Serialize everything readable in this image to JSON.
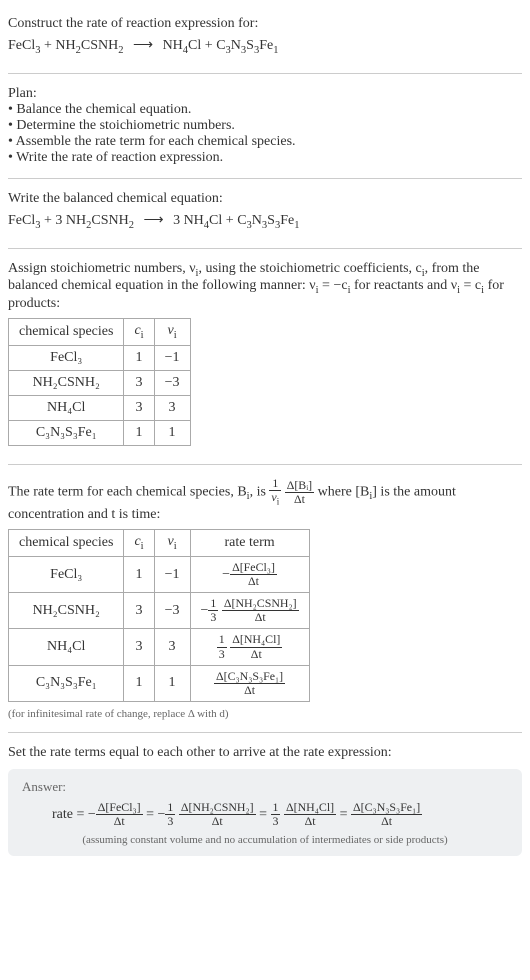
{
  "prompt": {
    "title": "Construct the rate of reaction expression for:",
    "eq_lhs1": "FeCl",
    "eq_lhs1_sub": "3",
    "plus1": " + ",
    "eq_lhs2": "NH",
    "eq_lhs2_sub1": "2",
    "eq_lhs2_mid": "CSNH",
    "eq_lhs2_sub2": "2",
    "arrow": "⟶",
    "eq_rhs1": "NH",
    "eq_rhs1_sub": "4",
    "eq_rhs1_tail": "Cl",
    "plus2": " + ",
    "eq_rhs2": "C",
    "eq_rhs2_sub1": "3",
    "eq_rhs2_mid1": "N",
    "eq_rhs2_sub2": "3",
    "eq_rhs2_mid2": "S",
    "eq_rhs2_sub3": "3",
    "eq_rhs2_mid3": "Fe",
    "eq_rhs2_sub4": "1"
  },
  "plan": {
    "heading": "Plan:",
    "items": [
      "Balance the chemical equation.",
      "Determine the stoichiometric numbers.",
      "Assemble the rate term for each chemical species.",
      "Write the rate of reaction expression."
    ]
  },
  "balanced": {
    "heading": "Write the balanced chemical equation:",
    "c1": "FeCl",
    "c1s": "3",
    "plus1": " + 3 ",
    "c2a": "NH",
    "c2s1": "2",
    "c2b": "CSNH",
    "c2s2": "2",
    "arrow": "⟶",
    "c3pre": " 3 ",
    "c3a": "NH",
    "c3s": "4",
    "c3b": "Cl",
    "plus2": " + ",
    "c4a": "C",
    "c4s1": "3",
    "c4b": "N",
    "c4s2": "3",
    "c4c": "S",
    "c4s3": "3",
    "c4d": "Fe",
    "c4s4": "1"
  },
  "stoich": {
    "text1": "Assign stoichiometric numbers, ν",
    "text1_sub": "i",
    "text2": ", using the stoichiometric coefficients, c",
    "text2_sub": "i",
    "text3": ", from the balanced chemical equation in the following manner: ν",
    "text3_sub": "i",
    "text4": " = −c",
    "text4_sub": "i",
    "text5": " for reactants and ν",
    "text5_sub": "i",
    "text6": " = c",
    "text6_sub": "i",
    "text7": " for products:",
    "headers": [
      "chemical species",
      "cᵢ",
      "νᵢ"
    ],
    "rows": [
      {
        "sp": "FeCl₃",
        "c": "1",
        "v": "−1"
      },
      {
        "sp": "NH₂CSNH₂",
        "c": "3",
        "v": "−3"
      },
      {
        "sp": "NH₄Cl",
        "c": "3",
        "v": "3"
      },
      {
        "sp": "C₃N₃S₃Fe₁",
        "c": "1",
        "v": "1"
      }
    ]
  },
  "rateterm_intro": {
    "t1": "The rate term for each chemical species, B",
    "t1_sub": "i",
    "t2": ", is ",
    "f1_num": "1",
    "f1_den": "νᵢ",
    "f2_num": "Δ[Bᵢ]",
    "f2_den": "Δt",
    "t3": " where [B",
    "t3_sub": "i",
    "t4": "] is the amount concentration and t is time:"
  },
  "rateterm_table": {
    "headers": [
      "chemical species",
      "cᵢ",
      "νᵢ",
      "rate term"
    ],
    "rows": [
      {
        "sp": "FeCl₃",
        "c": "1",
        "v": "−1",
        "neg": "−",
        "coef_num": "",
        "coef_den": "",
        "num": "Δ[FeCl₃]",
        "den": "Δt"
      },
      {
        "sp": "NH₂CSNH₂",
        "c": "3",
        "v": "−3",
        "neg": "−",
        "coef_num": "1",
        "coef_den": "3",
        "num": "Δ[NH₂CSNH₂]",
        "den": "Δt"
      },
      {
        "sp": "NH₄Cl",
        "c": "3",
        "v": "3",
        "neg": "",
        "coef_num": "1",
        "coef_den": "3",
        "num": "Δ[NH₄Cl]",
        "den": "Δt"
      },
      {
        "sp": "C₃N₃S₃Fe₁",
        "c": "1",
        "v": "1",
        "neg": "",
        "coef_num": "",
        "coef_den": "",
        "num": "Δ[C₃N₃S₃Fe₁]",
        "den": "Δt"
      }
    ],
    "note": "(for infinitesimal rate of change, replace Δ with d)"
  },
  "final": {
    "heading": "Set the rate terms equal to each other to arrive at the rate expression:",
    "answer_label": "Answer:",
    "rate_label": "rate = −",
    "t1_num": "Δ[FeCl₃]",
    "t1_den": "Δt",
    "eq1": " = −",
    "c2_num": "1",
    "c2_den": "3",
    "t2_num": "Δ[NH₂CSNH₂]",
    "t2_den": "Δt",
    "eq2": " = ",
    "c3_num": "1",
    "c3_den": "3",
    "t3_num": "Δ[NH₄Cl]",
    "t3_den": "Δt",
    "eq3": " = ",
    "t4_num": "Δ[C₃N₃S₃Fe₁]",
    "t4_den": "Δt",
    "note": "(assuming constant volume and no accumulation of intermediates or side products)"
  },
  "chart_data": {
    "type": "table",
    "tables": [
      {
        "title": "stoichiometric numbers",
        "columns": [
          "chemical species",
          "c_i",
          "nu_i"
        ],
        "rows": [
          [
            "FeCl3",
            1,
            -1
          ],
          [
            "NH2CSNH2",
            3,
            -3
          ],
          [
            "NH4Cl",
            3,
            3
          ],
          [
            "C3N3S3Fe1",
            1,
            1
          ]
        ]
      },
      {
        "title": "rate terms",
        "columns": [
          "chemical species",
          "c_i",
          "nu_i",
          "rate term"
        ],
        "rows": [
          [
            "FeCl3",
            1,
            -1,
            "-Δ[FeCl3]/Δt"
          ],
          [
            "NH2CSNH2",
            3,
            -3,
            "-(1/3) Δ[NH2CSNH2]/Δt"
          ],
          [
            "NH4Cl",
            3,
            3,
            "(1/3) Δ[NH4Cl]/Δt"
          ],
          [
            "C3N3S3Fe1",
            1,
            1,
            "Δ[C3N3S3Fe1]/Δt"
          ]
        ]
      }
    ]
  }
}
